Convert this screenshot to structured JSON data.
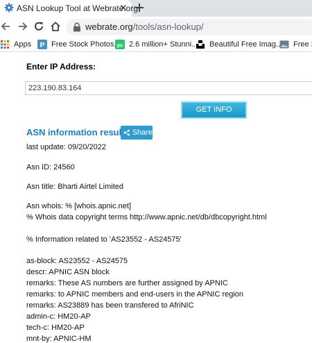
{
  "browser": {
    "tab": {
      "title": "ASN Lookup Tool at Webrate.org"
    },
    "omnibox": {
      "host": "webrate.org",
      "path": "/tools/asn-lookup/"
    },
    "bookmarks": [
      {
        "label": "Apps",
        "icon": "apps-grid-icon"
      },
      {
        "label": "Free Stock Photos,...",
        "icon": "pexels-icon"
      },
      {
        "label": "2.6 million+ Stunni...",
        "icon": "pixabay-icon"
      },
      {
        "label": "Beautiful Free Imag...",
        "icon": "unsplash-icon"
      },
      {
        "label": "Free Se",
        "icon": "image-icon"
      }
    ]
  },
  "form": {
    "label": "Enter IP Address:",
    "ip_value": "223.190.83.164",
    "submit_label": "GET INFO"
  },
  "result": {
    "title": "ASN information result",
    "share_label": "Share",
    "lines": [
      "last update: 09/20/2022",
      "Asn ID: 24560",
      "Asn title: Bharti Airtel Limited",
      "Asn whois: % [whois.apnic.net]",
      "% Whois data copyright terms http://www.apnic.net/db/dbcopyright.html",
      "% Information related to 'AS23552 - AS24575'",
      "as-block: AS23552 - AS24575",
      "descr: APNIC ASN block",
      "remarks: These AS numbers are further assigned by APNIC",
      "remarks: to APNIC members and end-users in the APNIC region",
      "remarks: AS23889 has been transfered to AfriNIC",
      "admin-c: HM20-AP",
      "tech-c: HM20-AP",
      "mnt-by: APNIC-HM"
    ]
  },
  "colors": {
    "accent": "#1b7fbf",
    "button": "#1a98c6",
    "share": "#2f9cd0",
    "tabstrip": "#dee1e6"
  }
}
